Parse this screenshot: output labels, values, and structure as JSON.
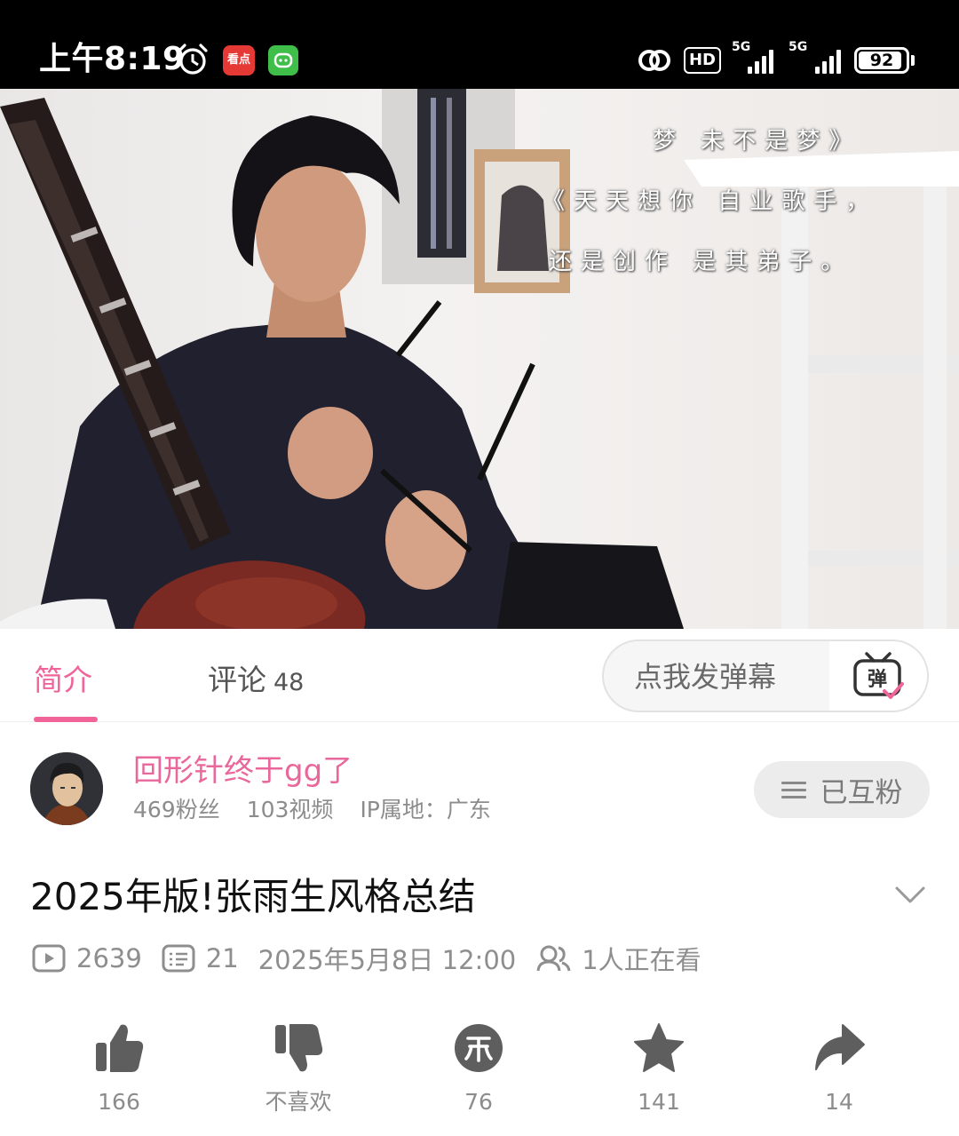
{
  "status_bar": {
    "time": "上午8:19",
    "app1_label": "看点",
    "hd_label": "HD",
    "sim1": "5G",
    "sim2": "5G",
    "battery": "92",
    "battery_level": 0.92
  },
  "video": {
    "subtitle_lines": [
      "梦    未不是梦》",
      "《天天想你   自业歌手，",
      "还是创作     是其弟子。"
    ]
  },
  "tabs": {
    "intro": "简介",
    "comments": "评论",
    "comments_count": "48"
  },
  "danmaku": {
    "placeholder": "点我发弹幕",
    "icon_label": "弹"
  },
  "uploader": {
    "name": "回形针终于gg了",
    "fans": "469粉丝",
    "videos": "103视频",
    "ip": "IP属地：广东",
    "follow_label": "已互粉"
  },
  "video_info": {
    "title": "2025年版!张雨生风格总结",
    "plays": "2639",
    "danmaku_count": "21",
    "datetime": "2025年5月8日 12:00",
    "watching": "1人正在看"
  },
  "actions": {
    "like_count": "166",
    "dislike_label": "不喜欢",
    "coin_count": "76",
    "favorite_count": "141",
    "share_count": "14"
  },
  "colors": {
    "accent_pink": "#f0649a",
    "status_bar_bg": "#000000",
    "icon_gray": "#5e5e5e"
  }
}
